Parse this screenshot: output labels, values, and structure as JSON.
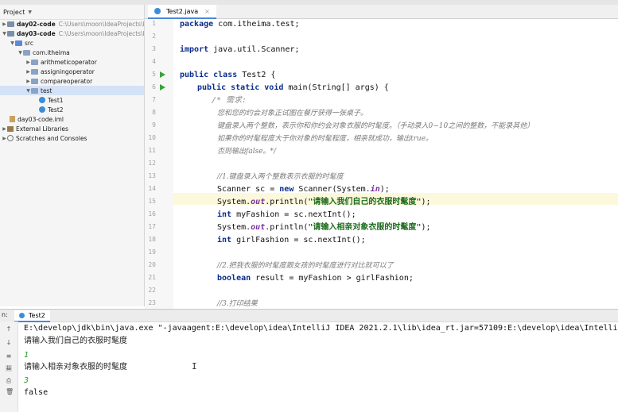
{
  "project_panel": {
    "title": "Project",
    "tree": [
      {
        "label": "day02-code",
        "sub": "C:\\Users\\moon\\IdeaProjects\\basic-co",
        "bold": true
      },
      {
        "label": "day03-code",
        "sub": "C:\\Users\\moon\\IdeaProjects\\basic-co",
        "bold": true
      },
      {
        "label": "src"
      },
      {
        "label": "com.itheima"
      },
      {
        "label": "arithmeticoperator"
      },
      {
        "label": "assigningoperator"
      },
      {
        "label": "compareoperator"
      },
      {
        "label": "test"
      },
      {
        "label": "Test1"
      },
      {
        "label": "Test2"
      },
      {
        "label": "day03-code.iml"
      },
      {
        "label": "External Libraries"
      },
      {
        "label": "Scratches and Consoles"
      }
    ]
  },
  "editor": {
    "tab_label": "Test2.java",
    "line_numbers": [
      "1",
      "2",
      "3",
      "4",
      "5",
      "6",
      "7",
      "8",
      "9",
      "10",
      "11",
      "12",
      "13",
      "14",
      "15",
      "16",
      "17",
      "18",
      "19",
      "20",
      "21",
      "22",
      "23"
    ],
    "code": {
      "l1_kw": "package",
      "l1_rest": " com.itheima.test;",
      "l3_kw": "import",
      "l3_rest": " java.util.Scanner;",
      "l5_kw": "public class",
      "l5_rest": " Test2 {",
      "l6_kw": "public static void",
      "l6_rest": " main(String[] args) {",
      "l7": "/* 需求:",
      "l8": "您和您的约会对象正试图在餐厅获得一张桌子。",
      "l9": "键盘录入两个整数，表示你和你约会对象衣服的时髦度。（手动录入0~10之间的整数，不能录其他）",
      "l10": "如果你的时髦程度大于你对象的时髦程度，相亲就成功，输出true。",
      "l11": "否则输出false。*/",
      "l13": "//1.键盘录入两个整数表示衣服的时髦度",
      "l14_a": "Scanner sc = ",
      "l14_kw": "new",
      "l14_b": " Scanner(System.",
      "l14_fld": "in",
      "l14_c": ");",
      "l15_a": "System.",
      "l15_fld": "out",
      "l15_b": ".println(",
      "l15_str": "\"请输入我们自己的衣服时髦度\"",
      "l15_c": ");",
      "l16_kw": "int",
      "l16_rest": " myFashion = sc.nextInt();",
      "l17_a": "System.",
      "l17_fld": "out",
      "l17_b": ".println(",
      "l17_str": "\"请输入相亲对象衣服的时髦度\"",
      "l17_c": ");",
      "l18_kw": "int",
      "l18_rest": " girlFashion = sc.nextInt();",
      "l20": "//2.把我衣服的时髦度跟女孩的时髦度进行对比就可以了",
      "l21_kw": "boolean",
      "l21_rest": " result = myFashion > girlFashion;",
      "l23": "//3.打印结果"
    }
  },
  "run_panel": {
    "label": "n:",
    "tab_label": "Test2",
    "cmd": "E:\\develop\\jdk\\bin\\java.exe \"-javaagent:E:\\develop\\idea\\IntelliJ IDEA 2021.2.1\\lib\\idea_rt.jar=57109:E:\\develop\\idea\\IntelliJ IDEA",
    "out1": "请输入我们自己的衣服时髦度",
    "in1": "1",
    "out2": "请输入相亲对象衣服的时髦度",
    "in2": "3",
    "result": "false"
  }
}
